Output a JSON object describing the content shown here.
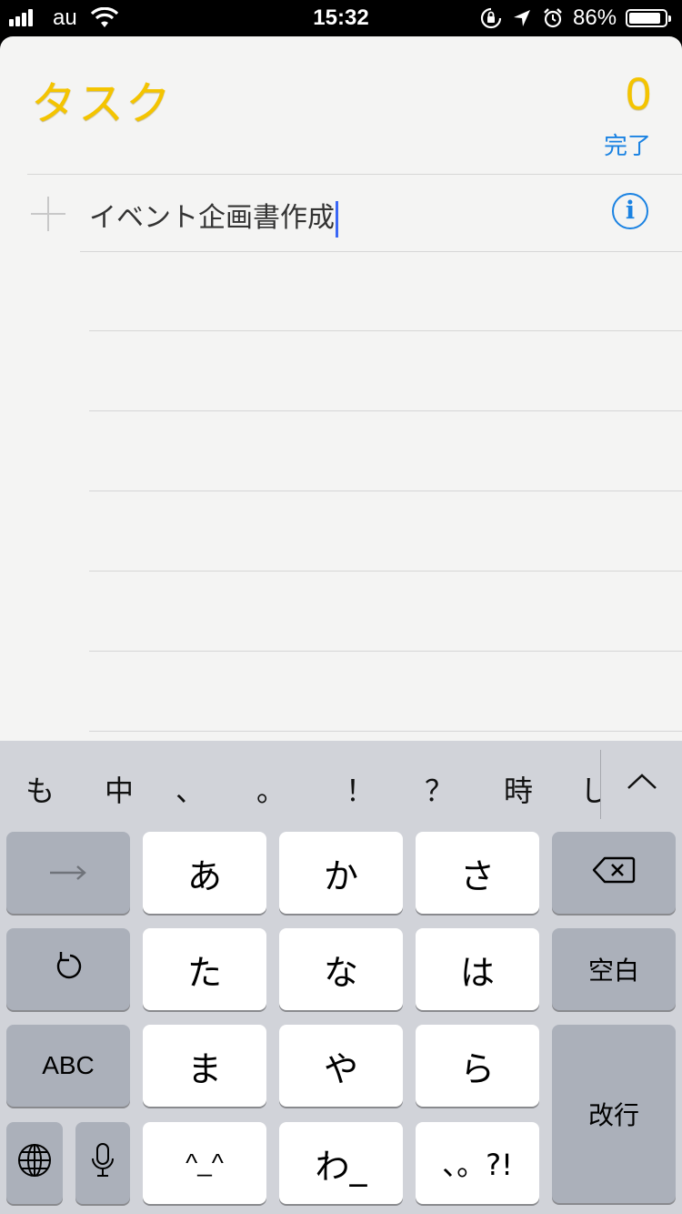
{
  "status": {
    "carrier": "au",
    "time": "15:32",
    "battery_pct": "86%"
  },
  "list": {
    "title": "タスク",
    "done_count": "0",
    "done_label": "完了",
    "task_text": "イベント企画書作成"
  },
  "keyboard": {
    "candidates": [
      "も",
      "中",
      "、",
      "。",
      "！",
      "？",
      "時",
      "し"
    ],
    "keys": {
      "a": "あ",
      "ka": "か",
      "sa": "さ",
      "ta": "た",
      "na": "な",
      "ha": "は",
      "ma": "ま",
      "ya": "や",
      "ra": "ら",
      "kaomoji": "^_^",
      "wa": "わ_",
      "punct": "、。?!",
      "abc": "ABC",
      "space": "空白",
      "return": "改行"
    }
  },
  "colors": {
    "accent_yellow": "#f4c400",
    "link_blue": "#1a82e2",
    "caret_blue": "#3b67f5"
  },
  "icons": [
    "signal-icon",
    "wifi-icon",
    "rotation-lock-icon",
    "location-icon",
    "alarm-icon",
    "battery-icon",
    "add-icon",
    "info-icon",
    "chevron-up-icon",
    "arrow-right-icon",
    "delete-icon",
    "undo-icon",
    "globe-icon",
    "microphone-icon"
  ]
}
